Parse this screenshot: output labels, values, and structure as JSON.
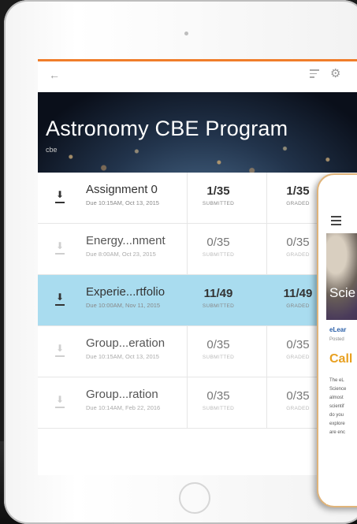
{
  "app": {
    "title": "Astronomy CBE Program",
    "subtitle": "cbe"
  },
  "toolbar": {
    "back_icon": "arrow-left-icon",
    "sort_icon": "sort-icon",
    "settings_icon": "gear-icon"
  },
  "colors": {
    "accent": "#f07d2a",
    "selected_row": "#a9dcef",
    "phone_headline": "#e8a020",
    "phone_link": "#2a5fa8"
  },
  "assignments": [
    {
      "title": "Assignment 0",
      "due": "Due 10:15AM, Oct 13, 2015",
      "submitted": "1/35",
      "submitted_label": "SUBMITTED",
      "graded": "1/35",
      "graded_label": "GRADED"
    },
    {
      "title": "Energy...nment",
      "due": "Due 8:00AM, Oct 23, 2015",
      "submitted": "0/35",
      "submitted_label": "SUBMITTED",
      "graded": "0/35",
      "graded_label": "GRADED"
    },
    {
      "title": "Experie...rtfolio",
      "due": "Due 10:00AM, Nov 11, 2015",
      "submitted": "11/49",
      "submitted_label": "SUBMITTED",
      "graded": "11/49",
      "graded_label": "GRADED"
    },
    {
      "title": "Group...eration",
      "due": "Due 10:15AM, Oct 13, 2015",
      "submitted": "0/35",
      "submitted_label": "SUBMITTED",
      "graded": "0/35",
      "graded_label": "GRADED"
    },
    {
      "title": "Group...ration",
      "due": "Due 10:14AM, Feb 22, 2016",
      "submitted": "0/35",
      "submitted_label": "SUBMITTED",
      "graded": "0/35",
      "graded_label": "GRADED"
    }
  ],
  "phone": {
    "menu_icon": "hamburger-menu-icon",
    "hero_text": "Scie",
    "link": "eLear",
    "posted": "Posted",
    "headline": "Call",
    "body_lines": [
      "The eL",
      "Science",
      "almost",
      "scientif",
      "do you",
      "explore",
      "are enc"
    ]
  }
}
